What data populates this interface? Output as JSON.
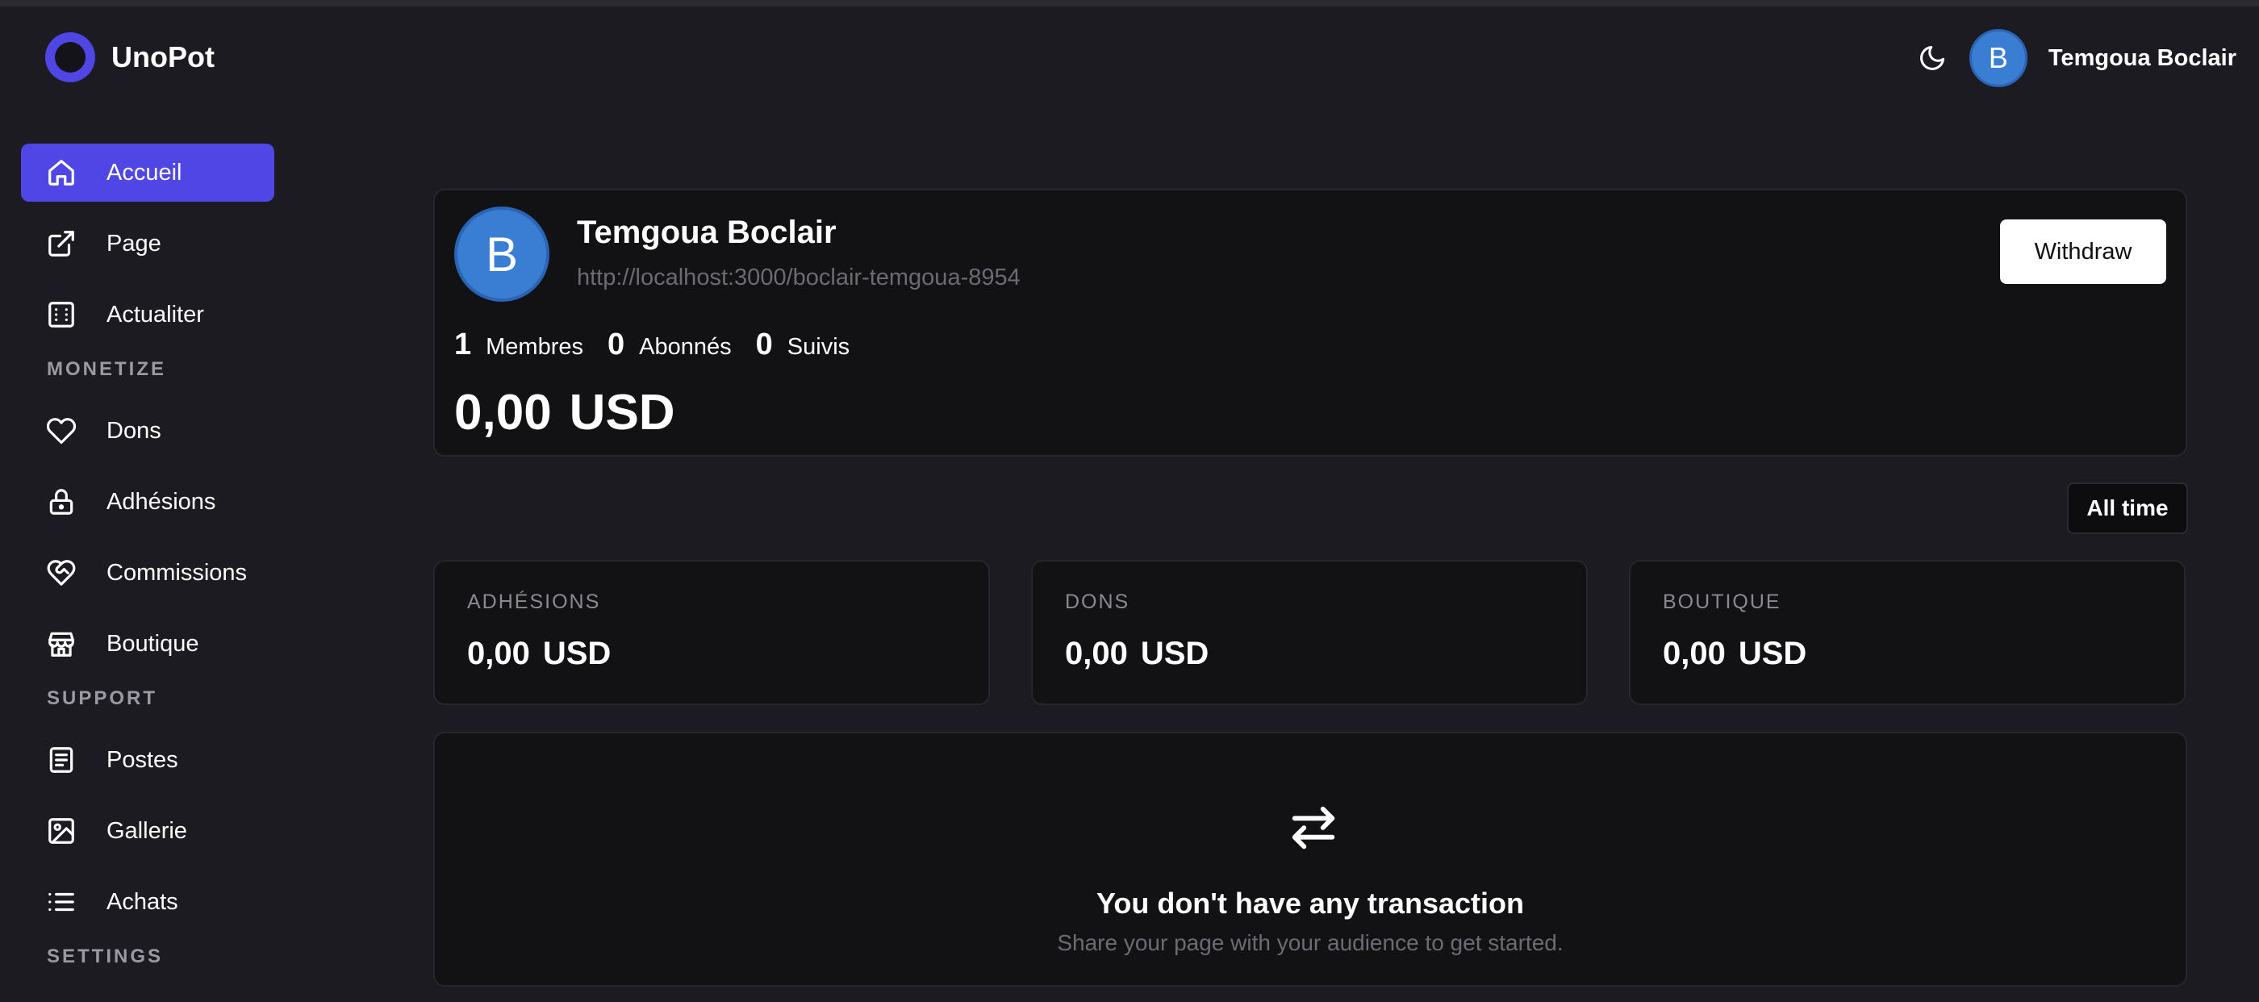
{
  "app": {
    "name": "UnoPot",
    "accent": "#4f46e5"
  },
  "header": {
    "user_name": "Temgoua Boclair",
    "avatar_initial": "B",
    "theme_icon": "moon-icon"
  },
  "sidebar": {
    "items_main": [
      {
        "label": "Accueil",
        "icon": "home-icon",
        "active": true
      },
      {
        "label": "Page",
        "icon": "external-link-icon"
      },
      {
        "label": "Actualiter",
        "icon": "news-icon"
      }
    ],
    "section_monetize": "MONETIZE",
    "items_monetize": [
      {
        "label": "Dons",
        "icon": "heart-icon"
      },
      {
        "label": "Adhésions",
        "icon": "lock-icon"
      },
      {
        "label": "Commissions",
        "icon": "heart-handshake-icon"
      },
      {
        "label": "Boutique",
        "icon": "store-icon"
      }
    ],
    "section_support": "SUPPORT",
    "items_support": [
      {
        "label": "Postes",
        "icon": "document-icon"
      },
      {
        "label": "Gallerie",
        "icon": "image-icon"
      },
      {
        "label": "Achats",
        "icon": "list-icon"
      }
    ],
    "section_settings": "SETTINGS"
  },
  "profile": {
    "avatar_initial": "B",
    "name": "Temgoua Boclair",
    "url": "http://localhost:3000/boclair-temgoua-8954",
    "withdraw_label": "Withdraw",
    "stats": [
      {
        "value": "1",
        "label": "Membres"
      },
      {
        "value": "0",
        "label": "Abonnés"
      },
      {
        "value": "0",
        "label": "Suivis"
      }
    ],
    "balance_amount": "0,00",
    "balance_currency": "USD"
  },
  "filter": {
    "label": "All time"
  },
  "metrics": [
    {
      "label": "ADHÉSIONS",
      "amount": "0,00",
      "currency": "USD"
    },
    {
      "label": "DONS",
      "amount": "0,00",
      "currency": "USD"
    },
    {
      "label": "BOUTIQUE",
      "amount": "0,00",
      "currency": "USD"
    }
  ],
  "empty_state": {
    "icon": "arrows-exchange-icon",
    "title": "You don't have any transaction",
    "subtitle": "Share your page with your audience to get started."
  }
}
